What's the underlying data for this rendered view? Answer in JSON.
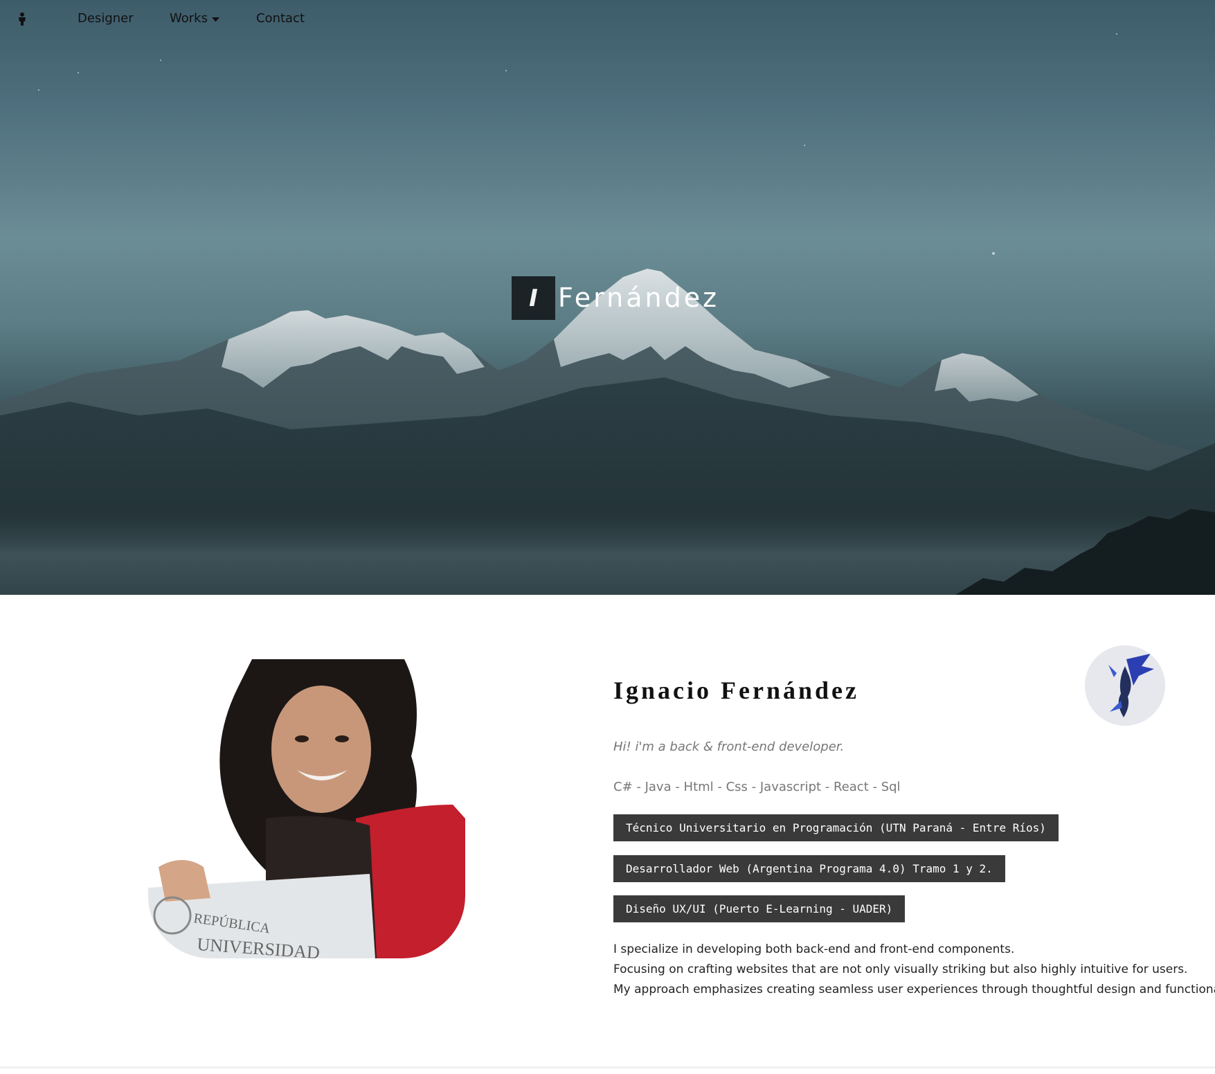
{
  "nav": {
    "home_icon": "person-icon",
    "links": [
      {
        "label": "Designer"
      },
      {
        "label": "Works"
      },
      {
        "label": "Contact"
      }
    ],
    "works_caret_icon": "caret-down-icon"
  },
  "hero": {
    "logo_initial": "I",
    "logo_name": "Fernández",
    "background": "mountain-landscape-photo"
  },
  "about": {
    "portrait": "portrait-photo",
    "avatar_icon": "dragon-icon",
    "name": "Ignacio Fernández",
    "tagline": "Hi! i'm a back & front-end developer.",
    "skills": "C# - Java - Html - Css - Javascript - React - Sql",
    "badges": [
      "Técnico Universitario en Programación (UTN Paraná - Entre Ríos)",
      "Desarrollador Web (Argentina Programa 4.0) Tramo 1 y 2.",
      "Diseño UX/UI (Puerto E-Learning - UADER)"
    ],
    "description": [
      "I specialize in developing both back-end and front-end components.",
      "Focusing on crafting websites that are not only visually striking but also highly intuitive for users.",
      "My approach emphasizes creating seamless user experiences through thoughtful design and functionality."
    ]
  },
  "colors": {
    "nav_text": "#111111",
    "logo_box": "#1b2326",
    "badge_bg": "#3a3a3a",
    "muted_text": "#777777"
  }
}
